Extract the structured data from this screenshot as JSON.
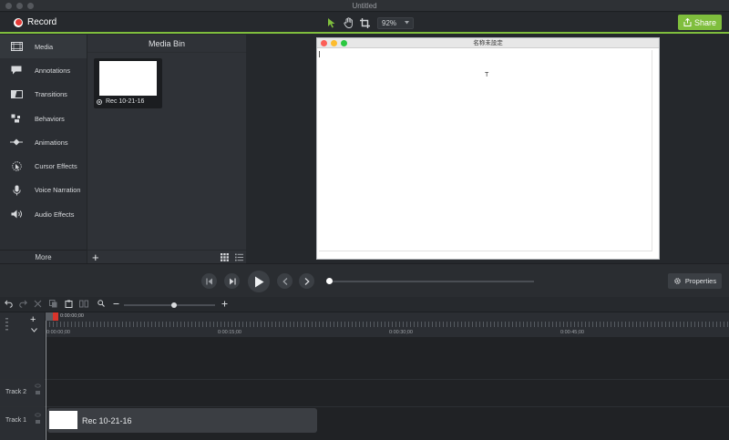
{
  "window": {
    "title": "Untitled"
  },
  "toolbar": {
    "record_label": "Record",
    "zoom": "92%",
    "share_label": "Share"
  },
  "sidebar": {
    "items": [
      {
        "label": "Media",
        "icon": "film-icon"
      },
      {
        "label": "Annotations",
        "icon": "annotation-icon"
      },
      {
        "label": "Transitions",
        "icon": "transition-icon"
      },
      {
        "label": "Behaviors",
        "icon": "behaviors-icon"
      },
      {
        "label": "Animations",
        "icon": "animation-icon"
      },
      {
        "label": "Cursor Effects",
        "icon": "cursor-effects-icon"
      },
      {
        "label": "Voice Narration",
        "icon": "microphone-icon"
      },
      {
        "label": "Audio Effects",
        "icon": "speaker-icon"
      }
    ],
    "more_label": "More"
  },
  "media_bin": {
    "title": "Media Bin",
    "items": [
      {
        "name": "Rec 10-21-16"
      }
    ]
  },
  "preview": {
    "window_title": "名称未設定",
    "cursor_glyph": "T"
  },
  "playback": {
    "properties_label": "Properties"
  },
  "timeline": {
    "playhead_time": "0:00:00;00",
    "ruler_labels": [
      "0:00:00;00",
      "0:00:15;00",
      "0:00:30;00",
      "0:00:45;00"
    ],
    "tracks": [
      {
        "label": "Track 2"
      },
      {
        "label": "Track 1",
        "clip": "Rec 10-21-16"
      }
    ]
  },
  "colors": {
    "accent": "#7fbe3d",
    "record": "#e53935",
    "background": "#25282c"
  }
}
